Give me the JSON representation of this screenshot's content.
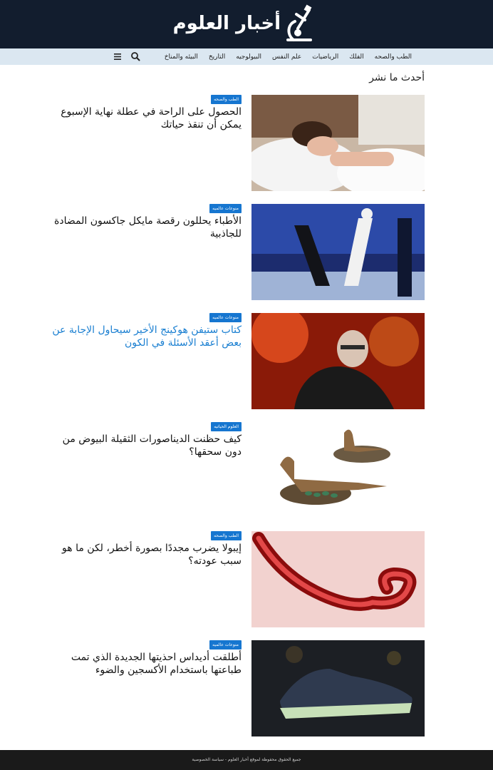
{
  "site": {
    "title": "أخبار العلوم"
  },
  "nav": {
    "items": [
      {
        "label": "الطب والصحه"
      },
      {
        "label": "الفلك"
      },
      {
        "label": "الرياضيات"
      },
      {
        "label": "علم النفس"
      },
      {
        "label": "البيولوجيه"
      },
      {
        "label": "التاريخ"
      },
      {
        "label": "البيئه والمناخ"
      }
    ],
    "search_icon": "search-icon",
    "menu_icon": "hamburger-menu-icon"
  },
  "section": {
    "title": "أحدث ما نشر"
  },
  "articles": [
    {
      "category": "الطب والصحه",
      "title": "الحصول على الراحة في عطلة نهاية الإسبوع يمكن أن تنقذ حياتك"
    },
    {
      "category": "منوعات عالميه",
      "title": "الأطباء يحللون رقصة مايكل جاكسون المضادة للجاذبية"
    },
    {
      "category": "منوعات عالميه",
      "title": "كتاب ستيفن هوكينج الأخير سيحاول الإجابة عن بعض أعقد الأسئلة في الكون"
    },
    {
      "category": "العلوم الحياتيه",
      "title": "كيف حظنت الديناصورات الثقيلة البيوض من دون سحقها؟"
    },
    {
      "category": "الطب والصحه",
      "title": "إيبولا يضرب مجددًا بصورة أخطر، لكن ما هو سبب عودته؟"
    },
    {
      "category": "منوعات عالميه",
      "title": "أطلقت أديداس احذيتها الجديدة الذي تمت طباعتها باستخدام الأكسجين والضوء"
    }
  ],
  "footer": {
    "text": "جميع الحقوق محفوظة لموقع أخبار العلوم - سياسة الخصوصية"
  },
  "colors": {
    "header_bg": "#121d2e",
    "nav_bg": "#dbe7f1",
    "badge_bg": "#1676d0",
    "link_active": "#1a7fd1",
    "footer_bg": "#1a1a1a"
  }
}
